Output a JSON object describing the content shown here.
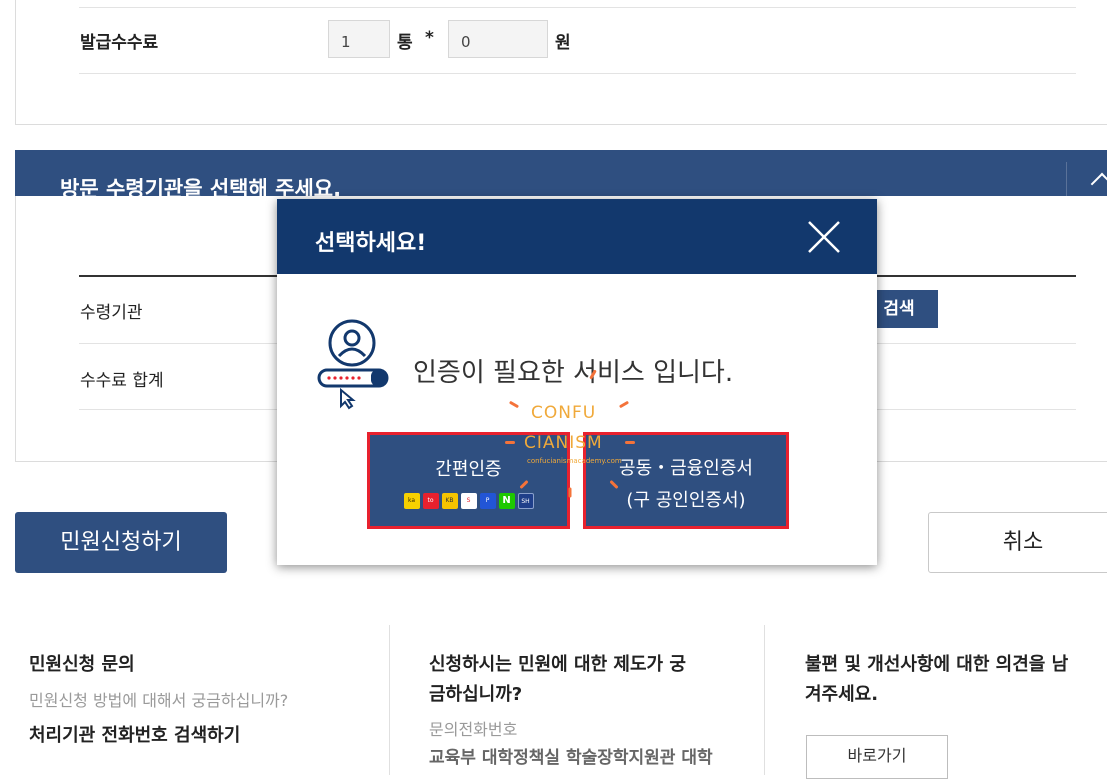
{
  "fee_section": {
    "label": "발급수수료",
    "copies_value": "1",
    "copies_unit": "통",
    "multiply": "*",
    "amount_value": "0",
    "amount_unit": "원"
  },
  "pickup_section": {
    "title": "방문 수령기관을 선택해 주세요.",
    "rows": [
      "수령기관",
      "수수료 합계"
    ],
    "search_label": "검색"
  },
  "actions": {
    "apply_label": "민원신청하기",
    "cancel_label": "취소"
  },
  "footer": {
    "col1": {
      "title": "민원신청 문의",
      "subtitle": "민원신청 방법에 대해서 궁금하십니까?",
      "link": "처리기관 전화번호 검색하기"
    },
    "col2": {
      "title_line1": "신청하시는 민원에 대한 제도가 궁",
      "title_line2": "금하십니까?",
      "subtitle": "문의전화번호",
      "detail": "교육부 대학정책실 학술장학지원관 대학"
    },
    "col3": {
      "title_line1": "불편 및 개선사항에 대한 의견을 남",
      "title_line2": "겨주세요.",
      "button": "바로가기"
    }
  },
  "modal": {
    "title": "선택하세요!",
    "message": "인증이 필요한 서비스 입니다.",
    "option1_label": "간편인증",
    "option2_line1": "공동・금융인증서",
    "option2_line2": "(구 공인인증서)",
    "provider_logos": [
      {
        "icon": "kakao-icon",
        "color": "#f7d100",
        "text": "kakao"
      },
      {
        "icon": "toss-icon",
        "color": "#e8212e",
        "text": "toss"
      },
      {
        "icon": "kb-icon",
        "color": "#f5c400",
        "text": "KB"
      },
      {
        "icon": "samsung-pass-icon",
        "color": "#e8212e",
        "text": "S"
      },
      {
        "icon": "pass-icon",
        "color": "#2255d6",
        "text": "Pass"
      },
      {
        "icon": "naver-icon",
        "color": "#1ec800",
        "text": "N"
      },
      {
        "icon": "shinhan-icon",
        "color": "#1f3f8a",
        "text": "SH"
      }
    ]
  },
  "watermark": {
    "line1": "CONFU",
    "line2": "CIANISM",
    "line3": "confucianismacademy.com"
  },
  "colors": {
    "navy": "#2f4f80",
    "modal_header": "#12386d",
    "highlight_border": "#e8212e",
    "watermark": "#f0a93a"
  }
}
